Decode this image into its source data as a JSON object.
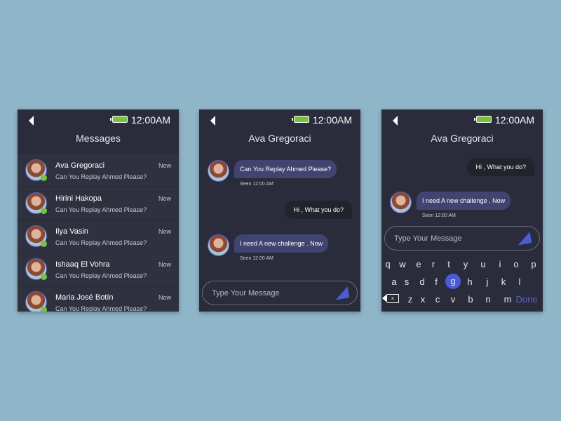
{
  "status": {
    "time": "12:00AM"
  },
  "list_screen": {
    "title": "Messages",
    "items": [
      {
        "name": "Ava Gregoraci",
        "message": "Can You Replay Ahmed Please?",
        "time": "Now"
      },
      {
        "name": "Hirini Hakopa",
        "message": "Can You Replay Ahmed Please?",
        "time": "Now"
      },
      {
        "name": "Ilya Vasin",
        "message": "Can You Replay Ahmed Please?",
        "time": "Now"
      },
      {
        "name": "Ishaaq El Vohra",
        "message": "Can You Replay Ahmed Please?",
        "time": "Now"
      },
      {
        "name": "Maria José Botín",
        "message": "Can You Replay Ahmed Please?",
        "time": "Now"
      }
    ]
  },
  "chat_screen": {
    "title": "Ava Gregoraci",
    "messages": [
      {
        "text": "Can You Replay Ahmed Please?",
        "seen": "Seen 12:00 AM"
      },
      {
        "text": "Hi , What you do?"
      },
      {
        "text": "I need A new challenge . Now",
        "seen": "Seen 12:00 AM"
      }
    ],
    "placeholder": "Type Your Message"
  },
  "keyboard_screen": {
    "title": "Ava Gregoraci",
    "messages": [
      {
        "text": "Hi , What you do?"
      },
      {
        "text": "I need A new challenge . Now",
        "seen": "Seen 12:00 AM"
      }
    ],
    "placeholder": "Type Your Message",
    "row1": [
      "q",
      "w",
      "e",
      "r",
      "t",
      "y",
      "u",
      "i",
      "o",
      "p"
    ],
    "row2": [
      "a",
      "s",
      "d",
      "f",
      "g",
      "h",
      "j",
      "k",
      "l"
    ],
    "row3": [
      "z",
      "x",
      "c",
      "v",
      "b",
      "n",
      "m"
    ],
    "done": "Done",
    "active_key": "g"
  },
  "colors": {
    "accent": "#4a5bd3",
    "online": "#7ac142",
    "background": "#8fb5c8",
    "panel": "#2b2c3b"
  }
}
